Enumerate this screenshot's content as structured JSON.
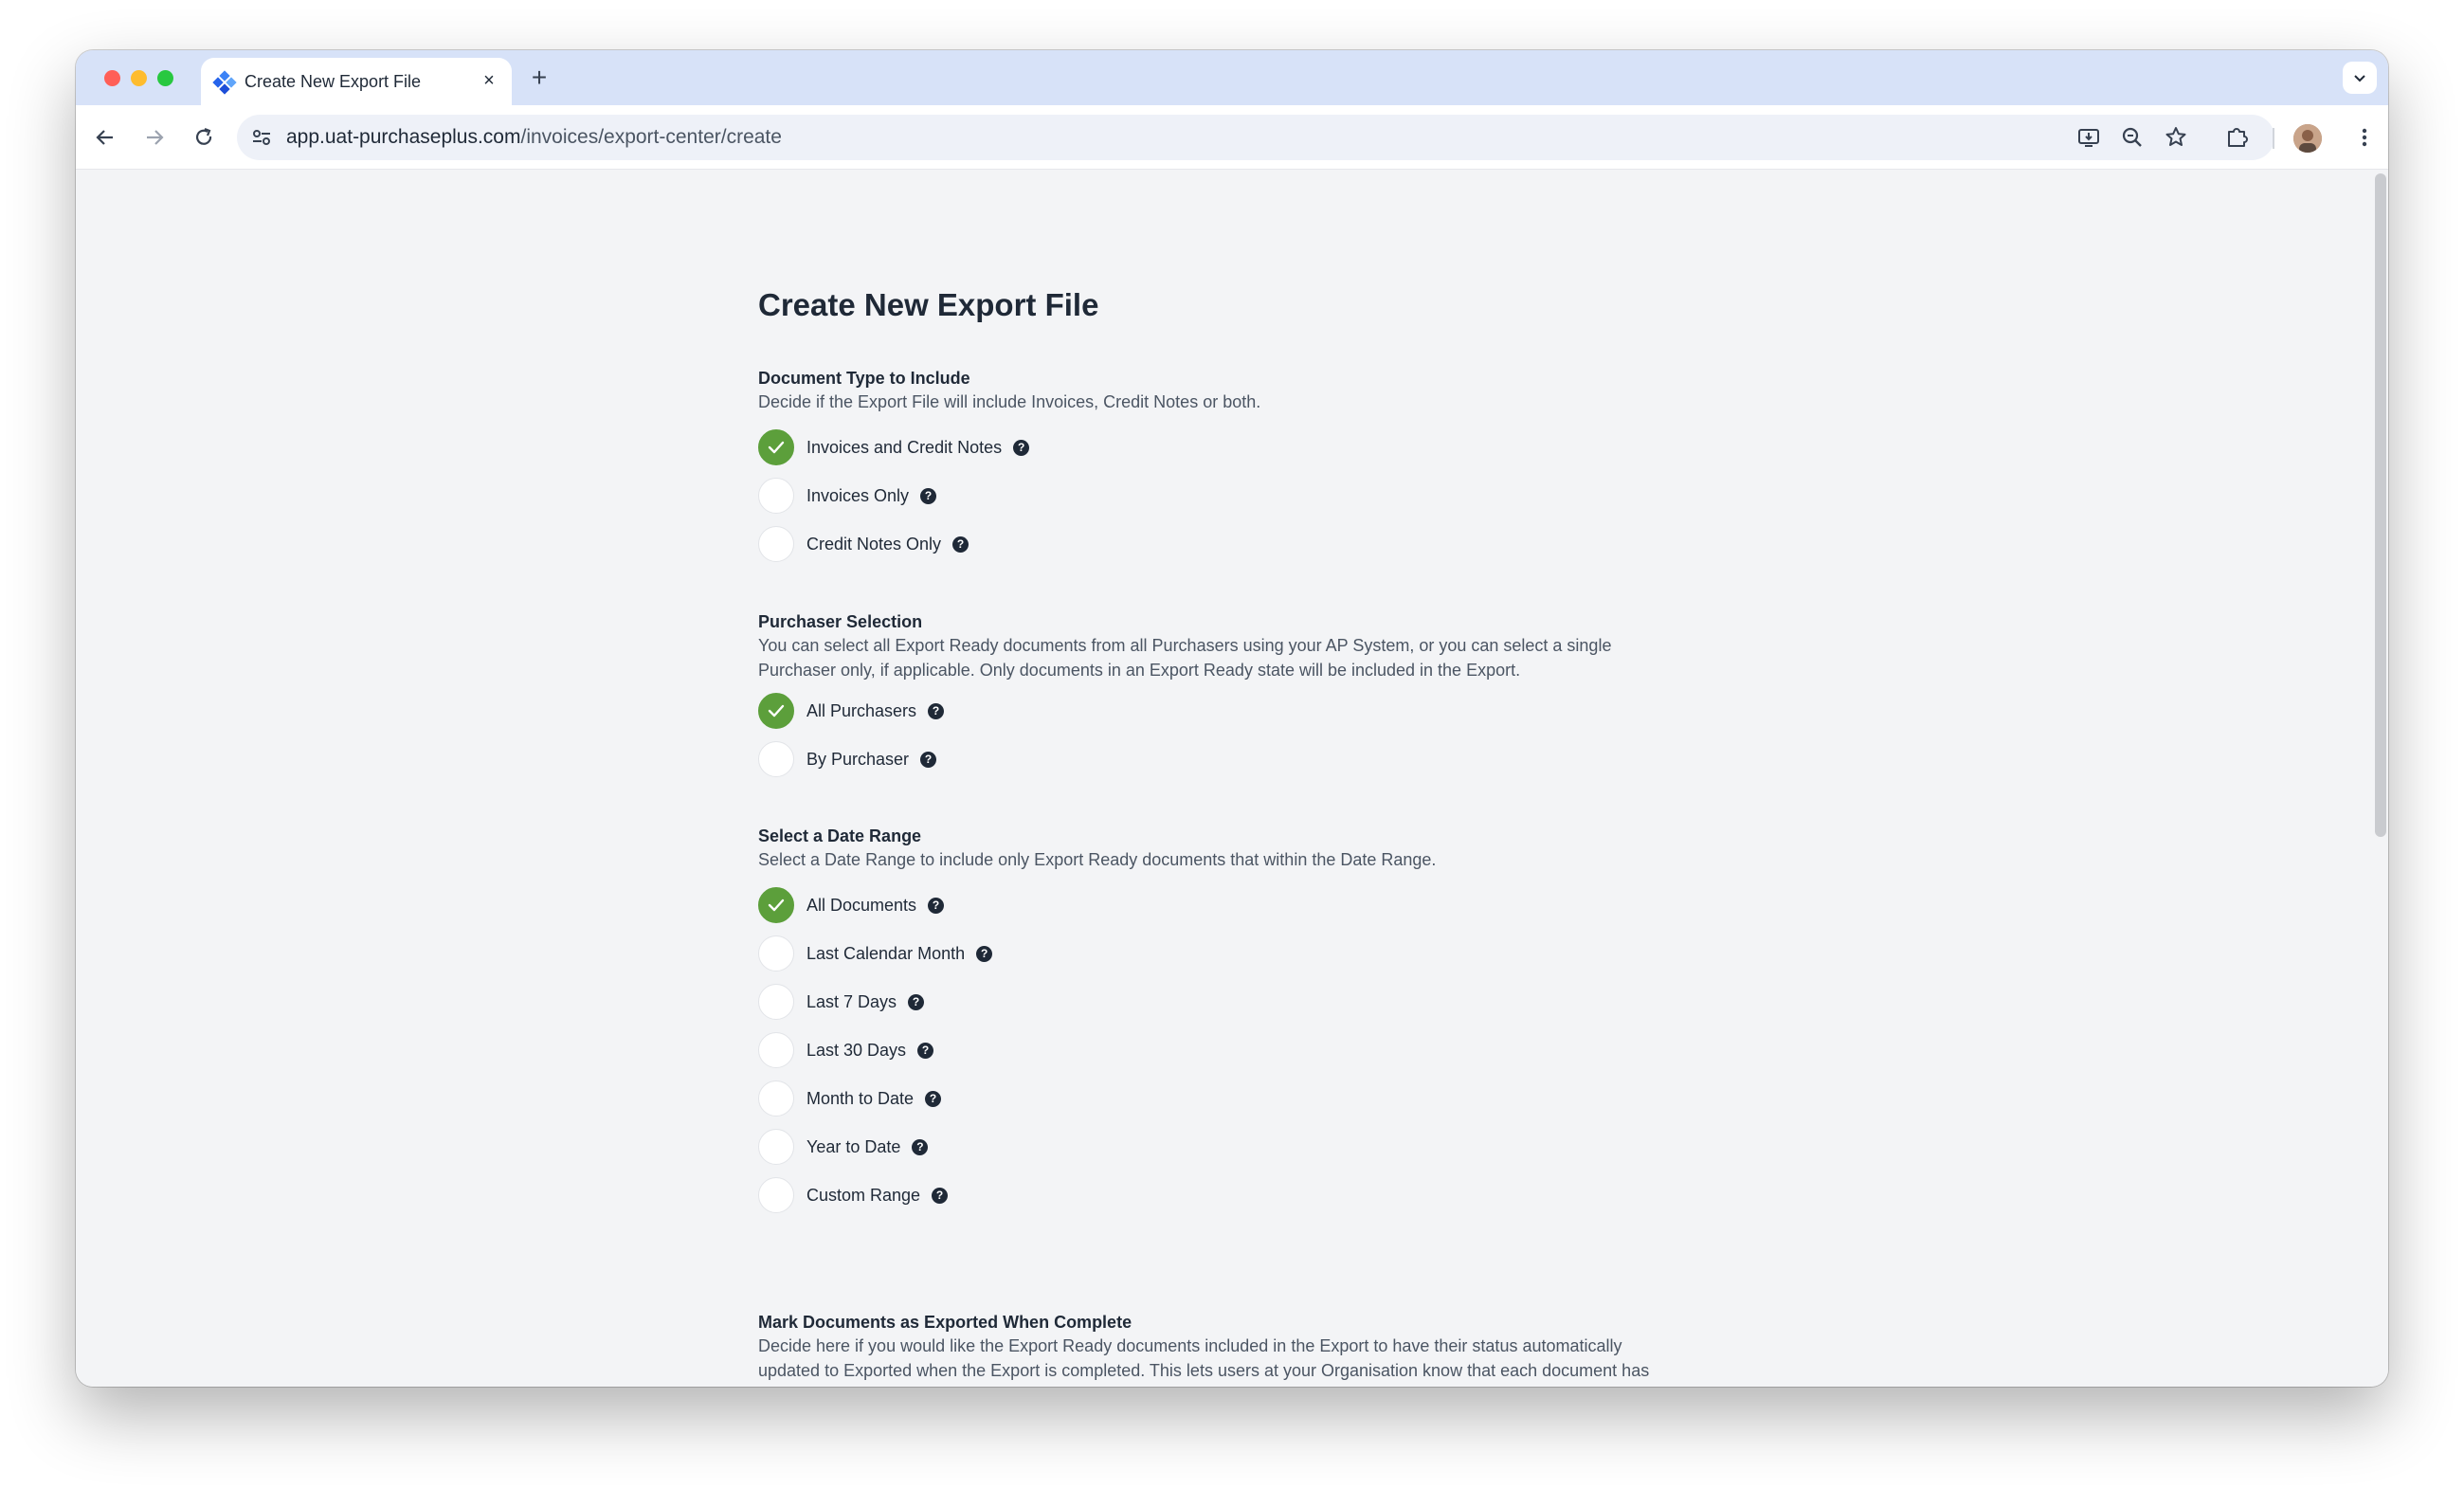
{
  "browser": {
    "tab_title": "Create New Export File",
    "tab_close": "×",
    "new_tab": "+",
    "url_host": "app.uat-purchaseplus.com",
    "url_path": "/invoices/export-center/create",
    "icons": [
      "back-arrow-icon",
      "forward-arrow-icon",
      "reload-icon",
      "site-info-icon",
      "install-app-icon",
      "zoom-icon",
      "bookmark-star-icon",
      "extensions-puzzle-icon",
      "kebab-menu-icon",
      "tab-list-chevron-icon"
    ]
  },
  "colors": {
    "accent_green": "#5c9f3b",
    "text_dark": "#1f2937",
    "text_muted": "#4b5563",
    "page_bg": "#f3f4f6",
    "tabstrip_bg": "#d7e2f8"
  },
  "page": {
    "title": "Create New Export File",
    "sections": [
      {
        "title": "Document Type to Include",
        "description": "Decide if the Export File will include Invoices, Credit Notes or both.",
        "options": [
          {
            "label": "Invoices and Credit Notes",
            "checked": true
          },
          {
            "label": "Invoices Only",
            "checked": false
          },
          {
            "label": "Credit Notes Only",
            "checked": false
          }
        ]
      },
      {
        "title": "Purchaser Selection",
        "description": "You can select all Export Ready documents from all Purchasers using your AP System, or you can select a single Purchaser only, if applicable. Only documents in an Export Ready state will be included in the Export.",
        "options": [
          {
            "label": "All Purchasers",
            "checked": true
          },
          {
            "label": "By Purchaser",
            "checked": false
          }
        ]
      },
      {
        "title": "Select a Date Range",
        "description": "Select a Date Range to include only Export Ready documents that within the Date Range.",
        "options": [
          {
            "label": "All Documents",
            "checked": true
          },
          {
            "label": "Last Calendar Month",
            "checked": false
          },
          {
            "label": "Last 7 Days",
            "checked": false
          },
          {
            "label": "Last 30 Days",
            "checked": false
          },
          {
            "label": "Month to Date",
            "checked": false
          },
          {
            "label": "Year to Date",
            "checked": false
          },
          {
            "label": "Custom Range",
            "checked": false
          }
        ]
      },
      {
        "title": "Mark Documents as Exported When Complete",
        "description": "Decide here if you would like the Export Ready documents included in the Export to have their status automatically updated to Exported when the Export is completed. This lets users at your Organisation know that each document has been Exported and has been fully finalised. If you decide to leave this un-checked, you can use the Mark As Exported option on the Export after it is completed."
      }
    ],
    "help_glyph": "?"
  }
}
